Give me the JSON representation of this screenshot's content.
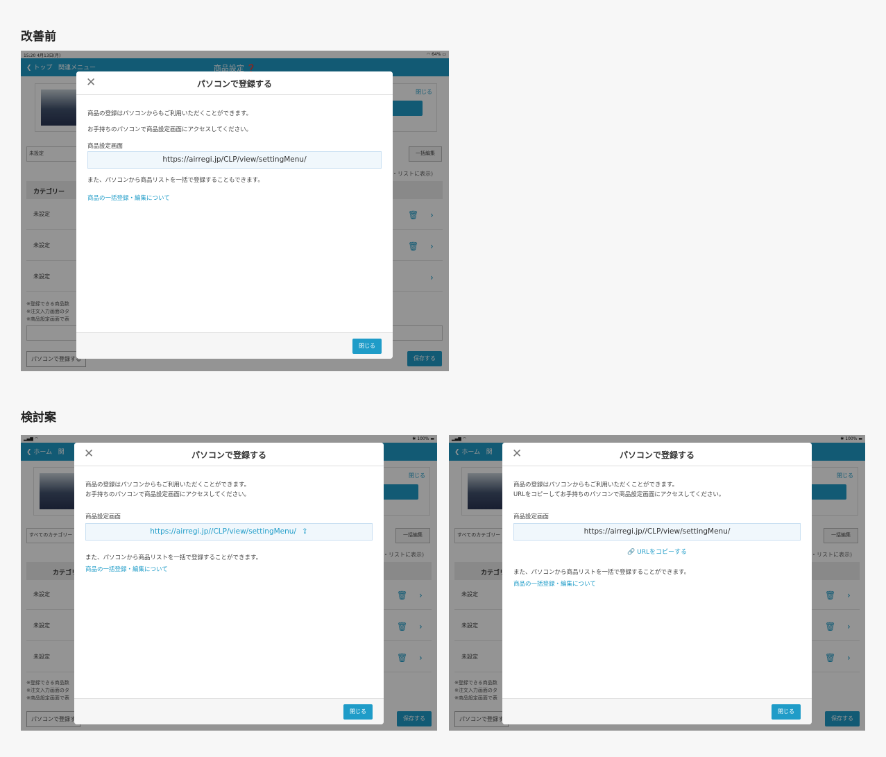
{
  "sections": {
    "before": "改善前",
    "proposal": "検討案"
  },
  "before": {
    "statusbar": {
      "left": "15:20 4月13日(月)",
      "right": "64%"
    },
    "nav": {
      "back": "トップ",
      "menu": "関連メニュー",
      "title": "商品設定"
    },
    "bg": {
      "close_small": "閉じる",
      "select1": "未設定",
      "bulk_edit": "一括編集",
      "list_view": "・リストに表示)",
      "category": "カテゴリー",
      "rows": [
        "未設定",
        "未設定",
        "未設定"
      ],
      "notes": [
        "※登録できる商品数",
        "※注文入力画面のタ",
        "※商品設定画面で表"
      ],
      "pc_register": "パソコンで登録する",
      "save": "保存する"
    },
    "modal": {
      "title": "パソコンで登録する",
      "line1": "商品の登録はパソコンからもご利用いただくことができます。",
      "line2": "お手持ちのパソコンで商品設定画面にアクセスしてください。",
      "label": "商品設定画面",
      "url": "https://airregi.jp/CLP/view/settingMenu/",
      "line3": "また、パソコンから商品リストを一括で登録することもできます。",
      "link": "商品の一括登録・編集について",
      "close_button": "閉じる"
    }
  },
  "proposalA": {
    "statusbar": {
      "left": "",
      "right": "100%"
    },
    "nav": {
      "back": "ホーム",
      "menu": "関"
    },
    "bg": {
      "close_small": "閉じる",
      "select1": "すべてのカテゴリー",
      "bulk_edit": "一括編集",
      "list_view": "・リストに表示)",
      "category": "カテゴリー",
      "rows": [
        "未設定",
        "未設定",
        "未設定"
      ],
      "notes": [
        "※登録できる商品数",
        "※注文入力画面のタ",
        "※商品設定画面で表"
      ],
      "pc_register": "パソコンで登録す",
      "save": "保存する"
    },
    "modal": {
      "title": "パソコンで登録する",
      "line1": "商品の登録はパソコンからもご利用いただくことができます。",
      "line2": "お手持ちのパソコンで商品設定画面にアクセスしてください。",
      "label": "商品設定画面",
      "url": "https://airregi.jp//CLP/view/settingMenu/",
      "line3": "また、パソコンから商品リストを一括で登録することができます。",
      "link": "商品の一括登録・編集について",
      "close_button": "閉じる"
    }
  },
  "proposalB": {
    "statusbar": {
      "left": "",
      "right": "100%"
    },
    "nav": {
      "back": "ホーム",
      "menu": "関"
    },
    "bg": {
      "close_small": "閉じる",
      "select1": "すべてのカテゴリー",
      "bulk_edit": "一括編集",
      "list_view": "・リストに表示)",
      "category": "カテゴリー",
      "rows": [
        "未設定",
        "未設定",
        "未設定"
      ],
      "notes": [
        "※登録できる商品数",
        "※注文入力画面のタ",
        "※商品設定画面で表"
      ],
      "pc_register": "パソコンで登録す",
      "save": "保存する"
    },
    "modal": {
      "title": "パソコンで登録する",
      "line1": "商品の登録はパソコンからもご利用いただくことができます。",
      "line2": "URLをコピーしてお手持ちのパソコンで商品設定画面にアクセスしてください。",
      "label": "商品設定画面",
      "url": "https://airregi.jp//CLP/view/settingMenu/",
      "copy": "URLをコピーする",
      "line3": "また、パソコンから商品リストを一括で登録することができます。",
      "link": "商品の一括登録・編集について",
      "close_button": "閉じる"
    }
  }
}
